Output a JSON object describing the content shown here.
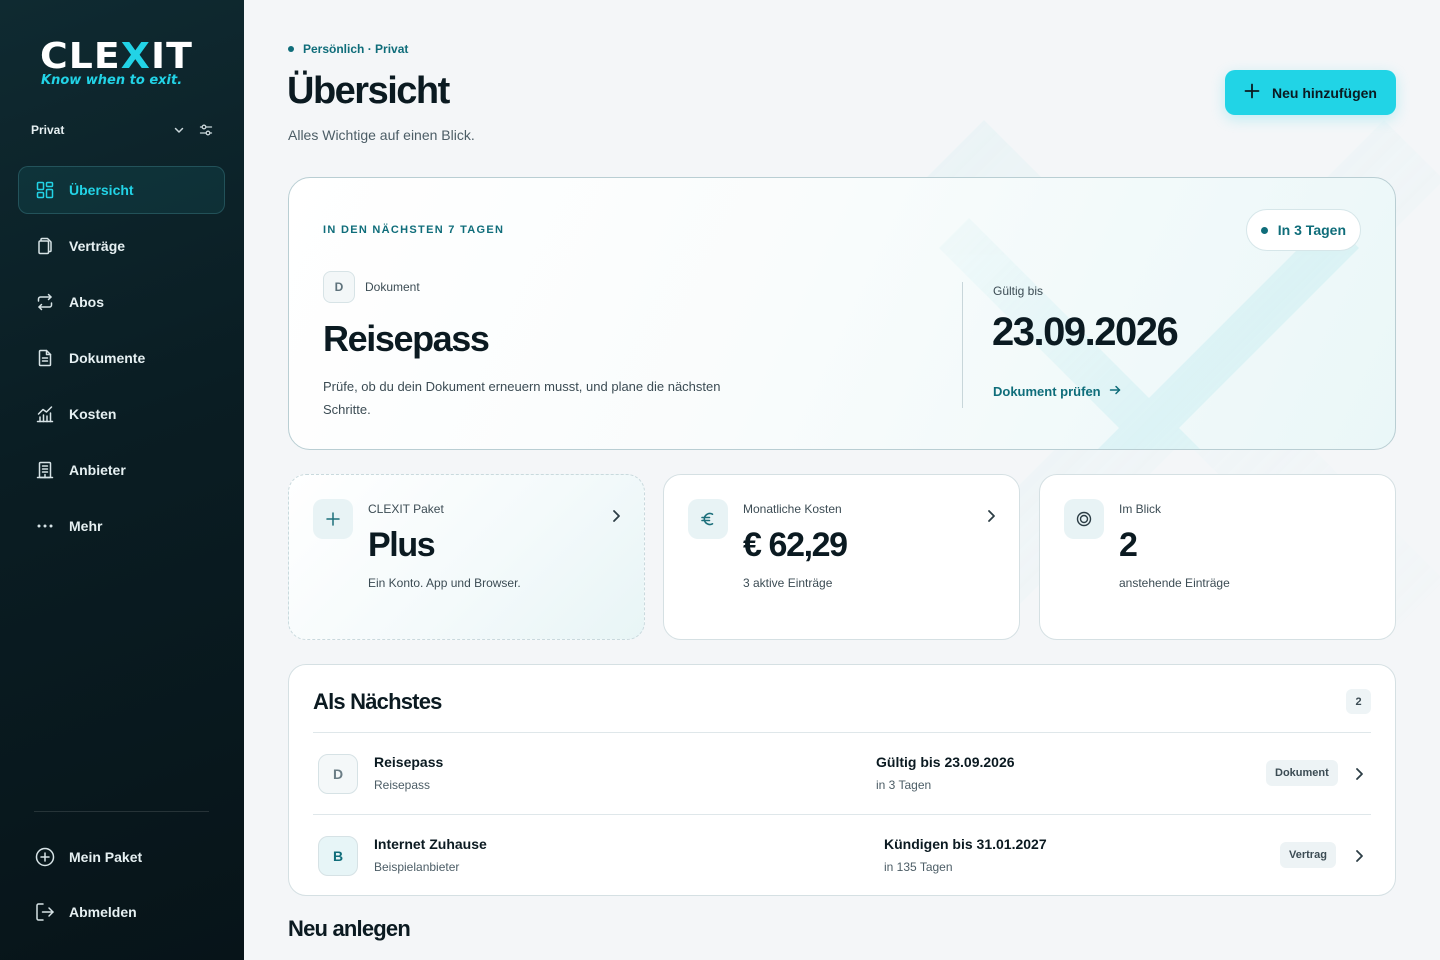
{
  "brand": {
    "name_part1": "CLE",
    "name_accent": "X",
    "name_part2": "IT",
    "tagline": "Know when to exit.",
    "accent_color": "#22d3e6"
  },
  "profile": {
    "current": "Privat",
    "icons": [
      "chevron-down-icon",
      "sliders-icon"
    ]
  },
  "nav": {
    "items": [
      {
        "label": "Übersicht",
        "icon": "dashboard-grid-icon",
        "active": true
      },
      {
        "label": "Verträge",
        "icon": "contracts-icon",
        "active": false
      },
      {
        "label": "Abos",
        "icon": "repeat-icon",
        "active": false
      },
      {
        "label": "Dokumente",
        "icon": "document-icon",
        "active": false
      },
      {
        "label": "Kosten",
        "icon": "cost-chart-icon",
        "active": false
      },
      {
        "label": "Anbieter",
        "icon": "provider-building-icon",
        "active": false
      },
      {
        "label": "Mehr",
        "icon": "more-dots-icon",
        "active": false
      }
    ],
    "bottom": [
      {
        "label": "Mein Paket",
        "icon": "plus-circle-icon"
      },
      {
        "label": "Abmelden",
        "icon": "logout-icon"
      }
    ]
  },
  "header": {
    "breadcrumb": "Persönlich · Privat",
    "title": "Übersicht",
    "subtitle": "Alles Wichtige auf einen Blick.",
    "add_button": "Neu hinzufügen"
  },
  "hero": {
    "kicker": "IN DEN NÄCHSTEN 7 TAGEN",
    "pill": "In 3 Tagen",
    "type_letter": "D",
    "type_label": "Dokument",
    "name": "Reisepass",
    "description": "Prüfe, ob du dein Dokument erneuern musst, und plane die nächsten Schritte.",
    "valid_label": "Gültig bis",
    "valid_date": "23.09.2026",
    "link": "Dokument prüfen"
  },
  "stats": [
    {
      "label": "CLEXIT Paket",
      "value": "Plus",
      "sub": "Ein Konto. App und Browser.",
      "icon": "plus-icon"
    },
    {
      "label": "Monatliche Kosten",
      "value": "€ 62,29",
      "sub": "3 aktive Einträge",
      "icon": "euro-icon"
    },
    {
      "label": "Im Blick",
      "value": "2",
      "sub": "anstehende Einträge",
      "icon": "target-icon"
    }
  ],
  "next": {
    "title": "Als Nächstes",
    "count": "2",
    "rows": [
      {
        "letter": "D",
        "title": "Reisepass",
        "sub": "Reisepass",
        "deadline": "Gültig bis 23.09.2026",
        "deadline_sub": "in 3 Tagen",
        "tag": "Dokument"
      },
      {
        "letter": "B",
        "title": "Internet Zuhause",
        "sub": "Beispielanbieter",
        "deadline": "Kündigen bis 31.01.2027",
        "deadline_sub": "in 135 Tagen",
        "tag": "Vertrag"
      }
    ]
  },
  "create_section": {
    "title": "Neu anlegen"
  }
}
